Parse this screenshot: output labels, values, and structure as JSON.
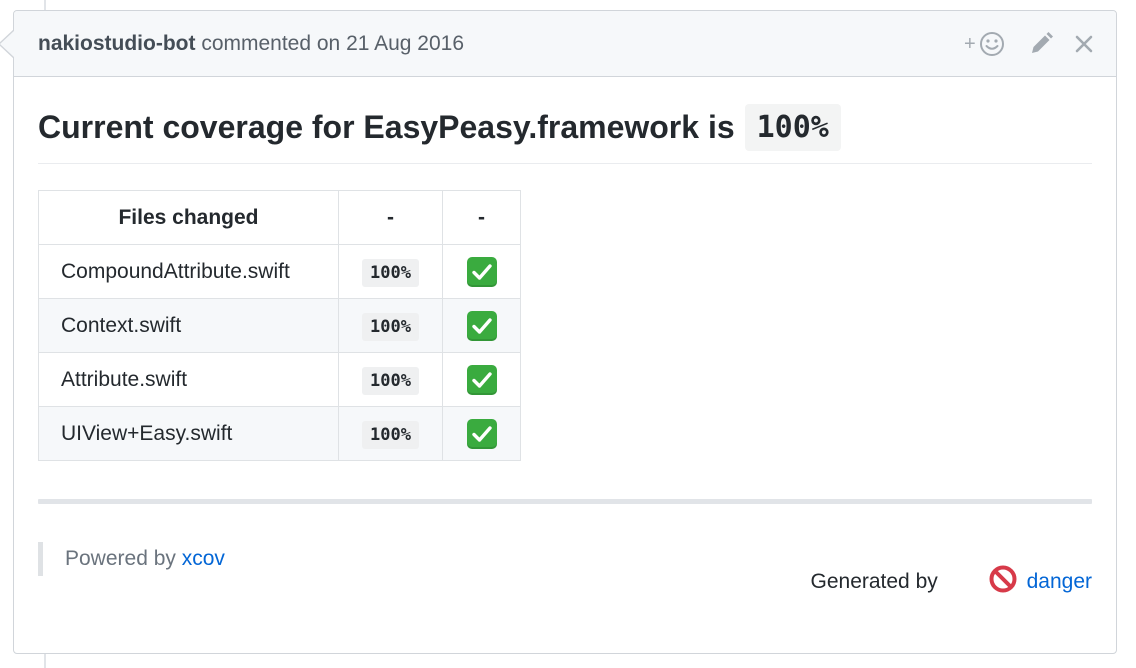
{
  "comment": {
    "author": "nakiostudio-bot",
    "action_text": " commented on ",
    "date": "21 Aug 2016",
    "icons": [
      "add-reaction-icon",
      "pencil-icon",
      "close-icon"
    ]
  },
  "heading": {
    "text": "Current coverage for EasyPeasy.framework is",
    "value": "100%"
  },
  "table": {
    "headers": [
      "Files changed",
      "-",
      "-"
    ],
    "rows": [
      {
        "file": "CompoundAttribute.swift",
        "coverage": "100%",
        "status": "check-mark-icon"
      },
      {
        "file": "Context.swift",
        "coverage": "100%",
        "status": "check-mark-icon"
      },
      {
        "file": "Attribute.swift",
        "coverage": "100%",
        "status": "check-mark-icon"
      },
      {
        "file": "UIView+Easy.swift",
        "coverage": "100%",
        "status": "check-mark-icon"
      }
    ]
  },
  "footer": {
    "powered_by_label": "Powered by ",
    "powered_by_link": "xcov",
    "generated_by_label": "Generated by ",
    "generated_by_link": "danger"
  },
  "colors": {
    "link": "#0366d6",
    "check": "#3aab3f",
    "danger_icon": "#d73a49"
  }
}
